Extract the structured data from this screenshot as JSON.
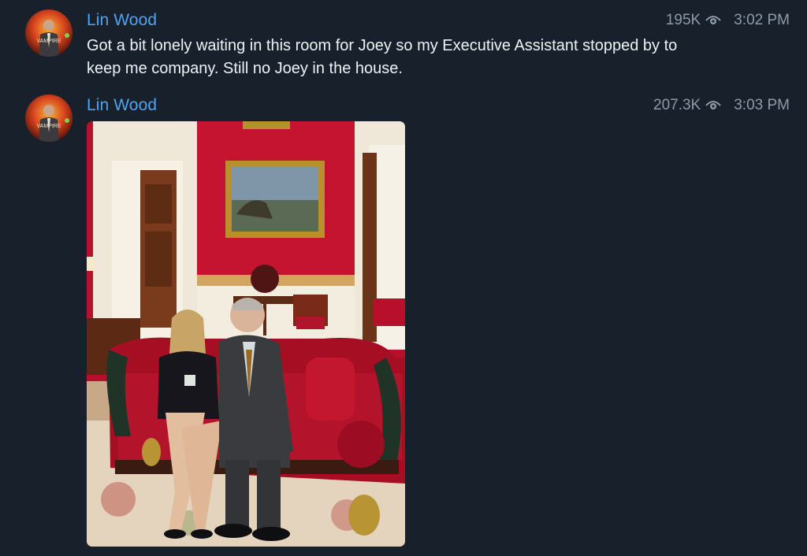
{
  "messages": [
    {
      "author": "Lin Wood",
      "views": "195K",
      "time": "3:02 PM",
      "text": "Got a bit lonely waiting in this room for Joey so my Executive Assistant stopped by to keep me company. Still no Joey in the house."
    },
    {
      "author": "Lin Wood",
      "views": "207.3K",
      "time": "3:03 PM",
      "photo_icon": "photo-of-two-people-on-red-sofa"
    }
  ],
  "colors": {
    "background": "#18202b",
    "author": "#4ea3f0",
    "meta": "#8e9aa8",
    "text": "#eef2f6"
  },
  "icons": {
    "views": "eye-icon"
  }
}
